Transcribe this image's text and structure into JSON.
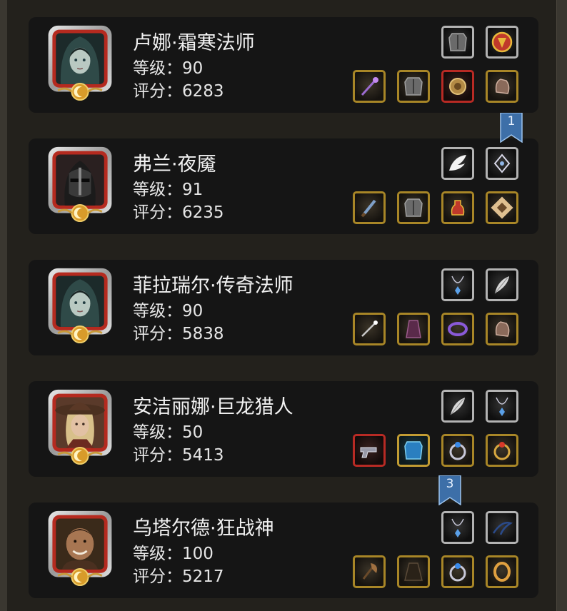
{
  "heroes": [
    {
      "name": "卢娜·霜寒法师",
      "level": "等级：90",
      "score": "评分：6283",
      "portrait": "hooded-mage",
      "top_slots": [
        {
          "icon": "chest-armor-icon",
          "frame": "silver"
        },
        {
          "icon": "shield-crest-icon",
          "frame": "silver"
        }
      ],
      "bottom_slots": [
        {
          "icon": "staff-icon",
          "frame": "gold"
        },
        {
          "icon": "chest-armor-icon",
          "frame": "gold"
        },
        {
          "icon": "amulet-icon",
          "frame": "red"
        },
        {
          "icon": "gloves-icon",
          "frame": "gold"
        }
      ]
    },
    {
      "name": "弗兰·夜魇",
      "level": "等级：91",
      "score": "评分：6235",
      "portrait": "black-knight",
      "top_slots": [
        {
          "icon": "wing-icon",
          "frame": "silver"
        },
        {
          "icon": "sigil-icon",
          "frame": "silver"
        }
      ],
      "bottom_slots": [
        {
          "icon": "dagger-icon",
          "frame": "gold"
        },
        {
          "icon": "chest-armor-icon",
          "frame": "gold"
        },
        {
          "icon": "potion-icon",
          "frame": "gold"
        },
        {
          "icon": "tome-icon",
          "frame": "gold"
        }
      ]
    },
    {
      "name": "菲拉瑞尔·传奇法师",
      "level": "等级：90",
      "score": "评分：5838",
      "portrait": "hooded-mage",
      "top_slots": [
        {
          "icon": "necklace-icon",
          "frame": "silver"
        },
        {
          "icon": "feather-icon",
          "frame": "silver"
        }
      ],
      "bottom_slots": [
        {
          "icon": "wand-icon",
          "frame": "gold"
        },
        {
          "icon": "robe-icon",
          "frame": "gold"
        },
        {
          "icon": "ring-purple-icon",
          "frame": "gold"
        },
        {
          "icon": "gloves-icon",
          "frame": "gold"
        }
      ]
    },
    {
      "name": "安洁丽娜·巨龙猎人",
      "level": "等级：50",
      "score": "评分：5413",
      "portrait": "hunter",
      "top_slots": [
        {
          "icon": "feather-icon",
          "frame": "silver"
        },
        {
          "icon": "necklace-icon",
          "frame": "silver"
        }
      ],
      "bottom_slots": [
        {
          "icon": "pistol-icon",
          "frame": "red"
        },
        {
          "icon": "blue-armor-icon",
          "frame": "teal"
        },
        {
          "icon": "ring-blue-icon",
          "frame": "gold"
        },
        {
          "icon": "ring-red-icon",
          "frame": "gold"
        }
      ]
    },
    {
      "name": "乌塔尔德·狂战神",
      "level": "等级：100",
      "score": "评分：5217",
      "portrait": "berserker",
      "top_slots": [
        {
          "icon": "necklace-icon",
          "frame": "silver"
        },
        {
          "icon": "whip-icon",
          "frame": "silver"
        }
      ],
      "bottom_slots": [
        {
          "icon": "axe-icon",
          "frame": "gold"
        },
        {
          "icon": "cloak-icon",
          "frame": "gold"
        },
        {
          "icon": "ring-blue-icon",
          "frame": "gold"
        },
        {
          "icon": "ring-gold-icon",
          "frame": "gold"
        }
      ]
    }
  ],
  "rank_badges": [
    {
      "label": "1"
    },
    {
      "label": "3"
    }
  ],
  "colors": {
    "card_bg": "#151515",
    "page_bg": "#23211c",
    "gold_frame": "#a88627",
    "silver_frame": "#b3b3b3",
    "red_frame": "#b82a24",
    "rank_blue": "#3d6fa8"
  }
}
